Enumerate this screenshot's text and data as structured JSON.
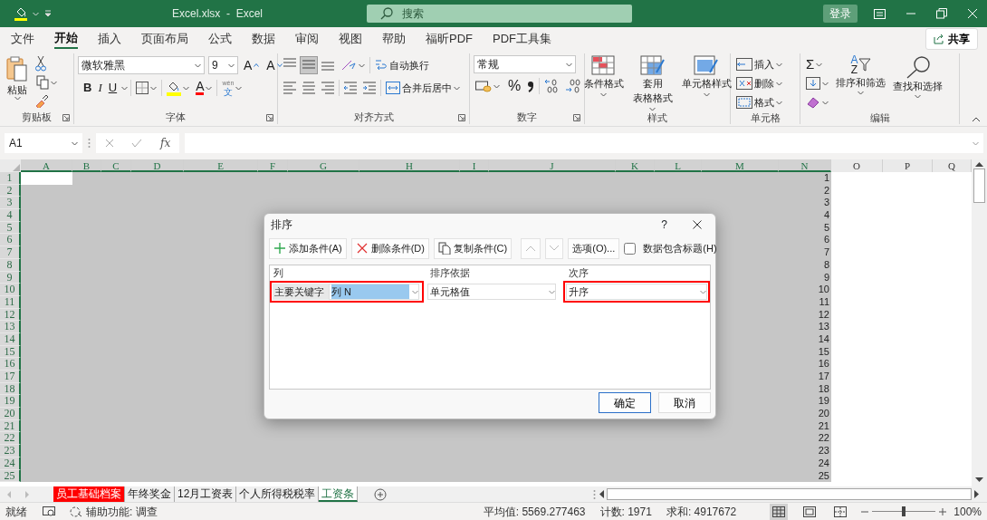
{
  "title_bar": {
    "title": "Excel.xlsx  -  Excel",
    "search_placeholder": "搜索",
    "sign_in": "登录"
  },
  "menu_tabs": [
    {
      "label": "文件",
      "selected": false
    },
    {
      "label": "开始",
      "selected": true
    },
    {
      "label": "插入",
      "selected": false
    },
    {
      "label": "页面布局",
      "selected": false
    },
    {
      "label": "公式",
      "selected": false
    },
    {
      "label": "数据",
      "selected": false
    },
    {
      "label": "审阅",
      "selected": false
    },
    {
      "label": "视图",
      "selected": false
    },
    {
      "label": "帮助",
      "selected": false
    },
    {
      "label": "福昕PDF",
      "selected": false
    },
    {
      "label": "PDF工具集",
      "selected": false
    }
  ],
  "share_button": "共享",
  "ribbon": {
    "clipboard": {
      "label": "剪贴板",
      "paste": "粘贴"
    },
    "font": {
      "label": "字体",
      "font_name": "微软雅黑",
      "font_size": "9",
      "grow": "A",
      "shrink": "A",
      "bold": "B",
      "italic": "I",
      "underline": "U",
      "font_color_letter": "A",
      "phonetic_ruby": "wén",
      "phonetic_base": "文"
    },
    "alignment": {
      "label": "对齐方式",
      "wrap_text": "自动换行",
      "merge_center": "合并后居中",
      "vertical_align": [
        {
          "kind": "top",
          "selected": false
        },
        {
          "kind": "middle",
          "selected": true
        },
        {
          "kind": "bottom",
          "selected": false
        }
      ]
    },
    "number": {
      "label": "数字",
      "format": "常规",
      "percent": "%"
    },
    "styles": {
      "label": "样式",
      "items": [
        {
          "kind": "conditional",
          "lines": [
            "条件格式"
          ]
        },
        {
          "kind": "table",
          "lines": [
            "套用",
            "表格格式"
          ]
        },
        {
          "kind": "cell",
          "lines": [
            "单元格样式"
          ]
        }
      ]
    },
    "cells": {
      "label": "单元格",
      "items": [
        {
          "kind": "insert",
          "label": "插入"
        },
        {
          "kind": "delete",
          "label": "删除"
        },
        {
          "kind": "format",
          "label": "格式"
        }
      ]
    },
    "editing": {
      "label": "编辑",
      "sum": "Σ",
      "sort_letters": [
        "A",
        "Z"
      ],
      "sort_filter": "排序和筛选",
      "find_select": "查找和选择"
    }
  },
  "formula_bar": {
    "name_box": "A1",
    "function_label": "fx"
  },
  "columns": [
    {
      "label": "A",
      "selected": true
    },
    {
      "label": "B",
      "selected": true
    },
    {
      "label": "C",
      "selected": true
    },
    {
      "label": "D",
      "selected": true
    },
    {
      "label": "E",
      "selected": true
    },
    {
      "label": "F",
      "selected": true
    },
    {
      "label": "G",
      "selected": true
    },
    {
      "label": "H",
      "selected": true
    },
    {
      "label": "I",
      "selected": true
    },
    {
      "label": "J",
      "selected": true
    },
    {
      "label": "K",
      "selected": true
    },
    {
      "label": "L",
      "selected": true
    },
    {
      "label": "M",
      "selected": true
    },
    {
      "label": "N",
      "selected": true
    },
    {
      "label": "O",
      "selected": false
    },
    {
      "label": "P",
      "selected": false
    },
    {
      "label": "Q",
      "selected": false
    }
  ],
  "rows": [
    {
      "label": "1",
      "n_value": "1"
    },
    {
      "label": "2",
      "n_value": "2"
    },
    {
      "label": "3",
      "n_value": "3"
    },
    {
      "label": "4",
      "n_value": "4"
    },
    {
      "label": "5",
      "n_value": "5"
    },
    {
      "label": "6",
      "n_value": "6"
    },
    {
      "label": "7",
      "n_value": "7"
    },
    {
      "label": "8",
      "n_value": "8"
    },
    {
      "label": "9",
      "n_value": "9"
    },
    {
      "label": "10",
      "n_value": "10"
    },
    {
      "label": "11",
      "n_value": "11"
    },
    {
      "label": "12",
      "n_value": "12"
    },
    {
      "label": "13",
      "n_value": "13"
    },
    {
      "label": "14",
      "n_value": "14"
    },
    {
      "label": "15",
      "n_value": "15"
    },
    {
      "label": "16",
      "n_value": "16"
    },
    {
      "label": "17",
      "n_value": "17"
    },
    {
      "label": "18",
      "n_value": "18"
    },
    {
      "label": "19",
      "n_value": "19"
    },
    {
      "label": "20",
      "n_value": "20"
    },
    {
      "label": "21",
      "n_value": "21"
    },
    {
      "label": "22",
      "n_value": "22"
    },
    {
      "label": "23",
      "n_value": "23"
    },
    {
      "label": "24",
      "n_value": "24"
    },
    {
      "label": "25",
      "n_value": "25"
    }
  ],
  "sort_dialog": {
    "title": "排序",
    "help": "?",
    "toolbar": [
      {
        "kind": "add",
        "label": "添加条件(A)",
        "disabled": false
      },
      {
        "kind": "delete",
        "label": "删除条件(D)",
        "disabled": false
      },
      {
        "kind": "copy",
        "label": "复制条件(C)",
        "disabled": false
      },
      {
        "kind": "up",
        "disabled": true
      },
      {
        "kind": "down",
        "disabled": true
      },
      {
        "kind": "options",
        "label": "选项(O)...",
        "disabled": false
      }
    ],
    "has_headers": {
      "label": "数据包含标题(H)",
      "checked": false
    },
    "headings": [
      "列",
      "排序依据",
      "次序"
    ],
    "criteria": [
      {
        "label": "主要关键字",
        "column": "列 N",
        "sort_on": "单元格值",
        "order": "升序",
        "column_highlighted": true,
        "order_highlighted": true
      }
    ],
    "ok": "确定",
    "cancel": "取消"
  },
  "sheet_tabs": [
    {
      "label": "员工基础档案",
      "selected": false,
      "color": "#ff0000"
    },
    {
      "label": "年终奖金",
      "selected": false
    },
    {
      "label": "12月工资表",
      "selected": false
    },
    {
      "label": "个人所得税税率",
      "selected": false
    },
    {
      "label": "工资条",
      "selected": true
    }
  ],
  "status_bar": {
    "ready": "就绪",
    "accessibility": "辅助功能: 调查",
    "average": "平均值: 5569.277463",
    "count": "计数: 1971",
    "sum": "求和: 4917672",
    "views": [
      {
        "kind": "normal",
        "selected": true
      },
      {
        "kind": "page_layout",
        "selected": false
      },
      {
        "kind": "page_break",
        "selected": false
      }
    ],
    "zoom": {
      "level": 0.5,
      "label": "100%"
    }
  }
}
